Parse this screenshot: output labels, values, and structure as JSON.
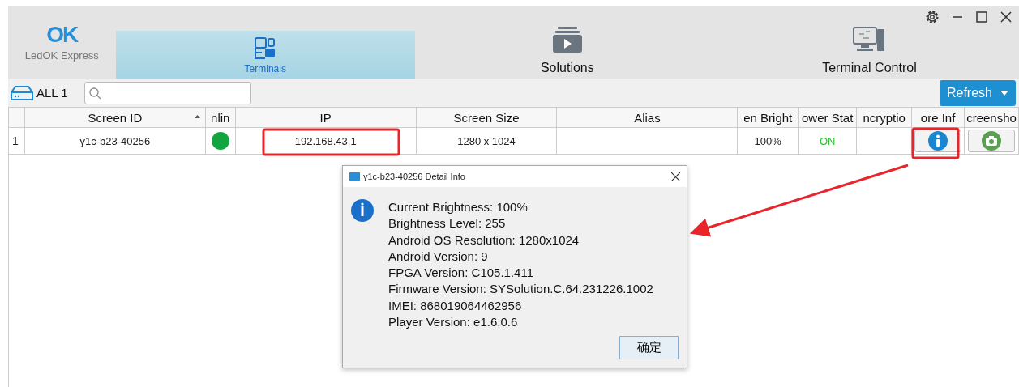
{
  "app": {
    "logo_mark": "OK",
    "name": "LedOK Express"
  },
  "tabs": [
    {
      "label": "Terminals",
      "selected": true,
      "kind": "terminals"
    },
    {
      "label": "Solutions",
      "selected": false,
      "kind": "solutions"
    },
    {
      "label": "Terminal Control",
      "selected": false,
      "kind": "control"
    }
  ],
  "toolbar": {
    "all_label": "ALL 1",
    "refresh": "Refresh"
  },
  "table": {
    "columns": [
      {},
      {
        "label": "Screen ID",
        "sorted": true
      },
      {
        "label": "nlin"
      },
      {
        "label": "IP"
      },
      {
        "label": "Screen Size"
      },
      {
        "label": "Alias"
      },
      {
        "label": "en Bright"
      },
      {
        "label": "ower Stat"
      },
      {
        "label": "ncryptio"
      },
      {
        "label": "ore Inf"
      },
      {
        "label": "creensho"
      }
    ],
    "rows": [
      {
        "index": "1",
        "screen_id": "y1c-b23-40256",
        "online": true,
        "ip": "192.168.43.1",
        "screen_size": "1280 x 1024",
        "brightness": "100%",
        "power": "ON"
      }
    ]
  },
  "dialog": {
    "title": "y1c-b23-40256 Detail Info",
    "lines": [
      "Current Brightness: 100%",
      "Brightness Level: 255",
      "Android OS Resolution: 1280x1024",
      "Android Version: 9",
      "FPGA Version: C105.1.411",
      "Firmware Version: SYSolution.C.64.231226.1002",
      "IMEI: 868019064462956",
      "Player Version: e1.6.0.6"
    ],
    "ok": "确定"
  }
}
